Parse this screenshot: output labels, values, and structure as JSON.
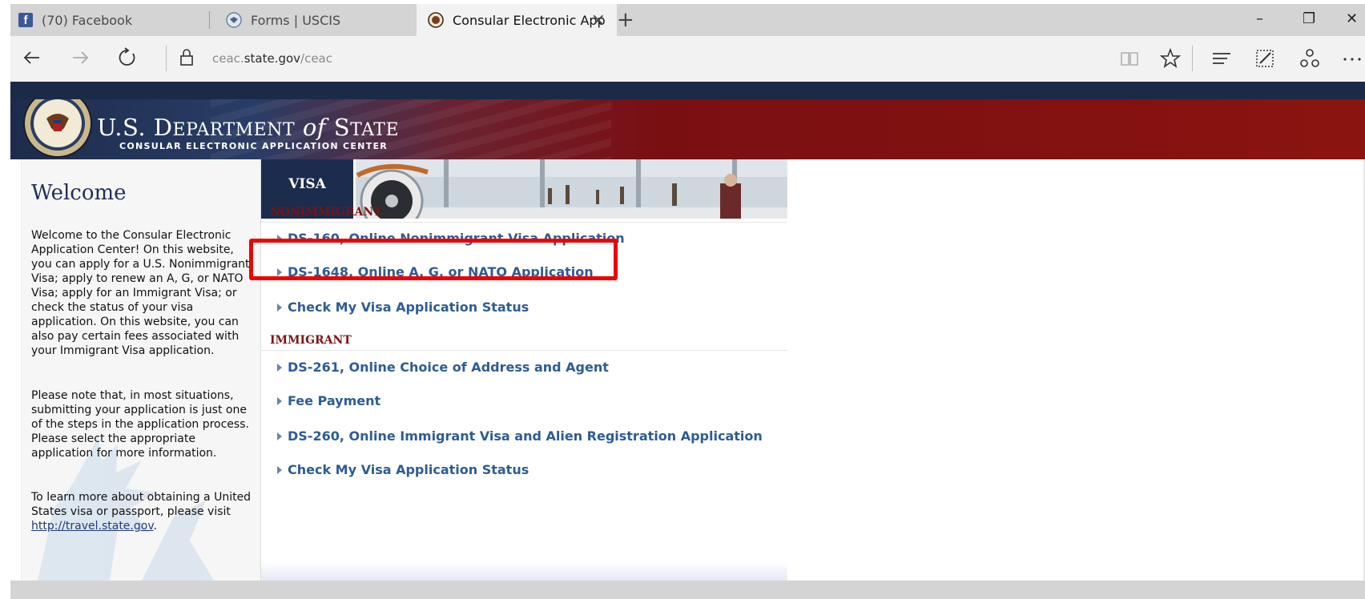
{
  "browser": {
    "tabs": [
      {
        "label": "(70) Facebook",
        "icon": "facebook-icon"
      },
      {
        "label": "Forms | USCIS",
        "icon": "uscis-seal-icon"
      },
      {
        "label": "Consular Electronic App",
        "icon": "state-seal-icon",
        "active": true
      }
    ],
    "url_prefix": "ceac.",
    "url_host": "state.gov",
    "url_path": "/ceac"
  },
  "header": {
    "title_us": "U.S. D",
    "title_ep": "EPARTMENT",
    "title_of": "of",
    "title_s": "S",
    "title_tate": "TATE",
    "subtitle": "CONSULAR ELECTRONIC APPLICATION CENTER"
  },
  "welcome": {
    "title": "Welcome",
    "para1": "Welcome to the Consular Electronic Application Center! On this website, you can apply for a U.S. Nonimmigrant Visa; apply to renew an A, G, or NATO Visa; apply for an Immigrant Visa; or check the status of your visa application. On this website, you can also pay certain fees associated with your Immigrant Visa application.",
    "para2": "Please note that, in most situations, submitting your application is just one of the steps in the application process. Please select the appropriate application for more information.",
    "para3_prefix": "To learn more about obtaining a United States visa or passport, please visit ",
    "para3_link": "http://travel.state.gov",
    "para3_suffix": "."
  },
  "visa": {
    "tab_label": "VISA",
    "nonimmigrant_heading": "NONIMMIGRANT",
    "nonimmigrant_links": [
      "DS-160, Online Nonimmigrant Visa Application",
      "DS-1648, Online A, G, or NATO Application",
      "Check My Visa Application Status"
    ],
    "immigrant_heading": "IMMIGRANT",
    "immigrant_links": [
      "DS-261, Online Choice of Address and Agent",
      "Fee Payment",
      "DS-260, Online Immigrant Visa and Alien Registration Application",
      "Check My Visa Application Status"
    ]
  },
  "colors": {
    "link": "#2e5c94",
    "section_heading": "#7a1414",
    "navy": "#1c2c4e",
    "highlight": "#ee0000"
  }
}
